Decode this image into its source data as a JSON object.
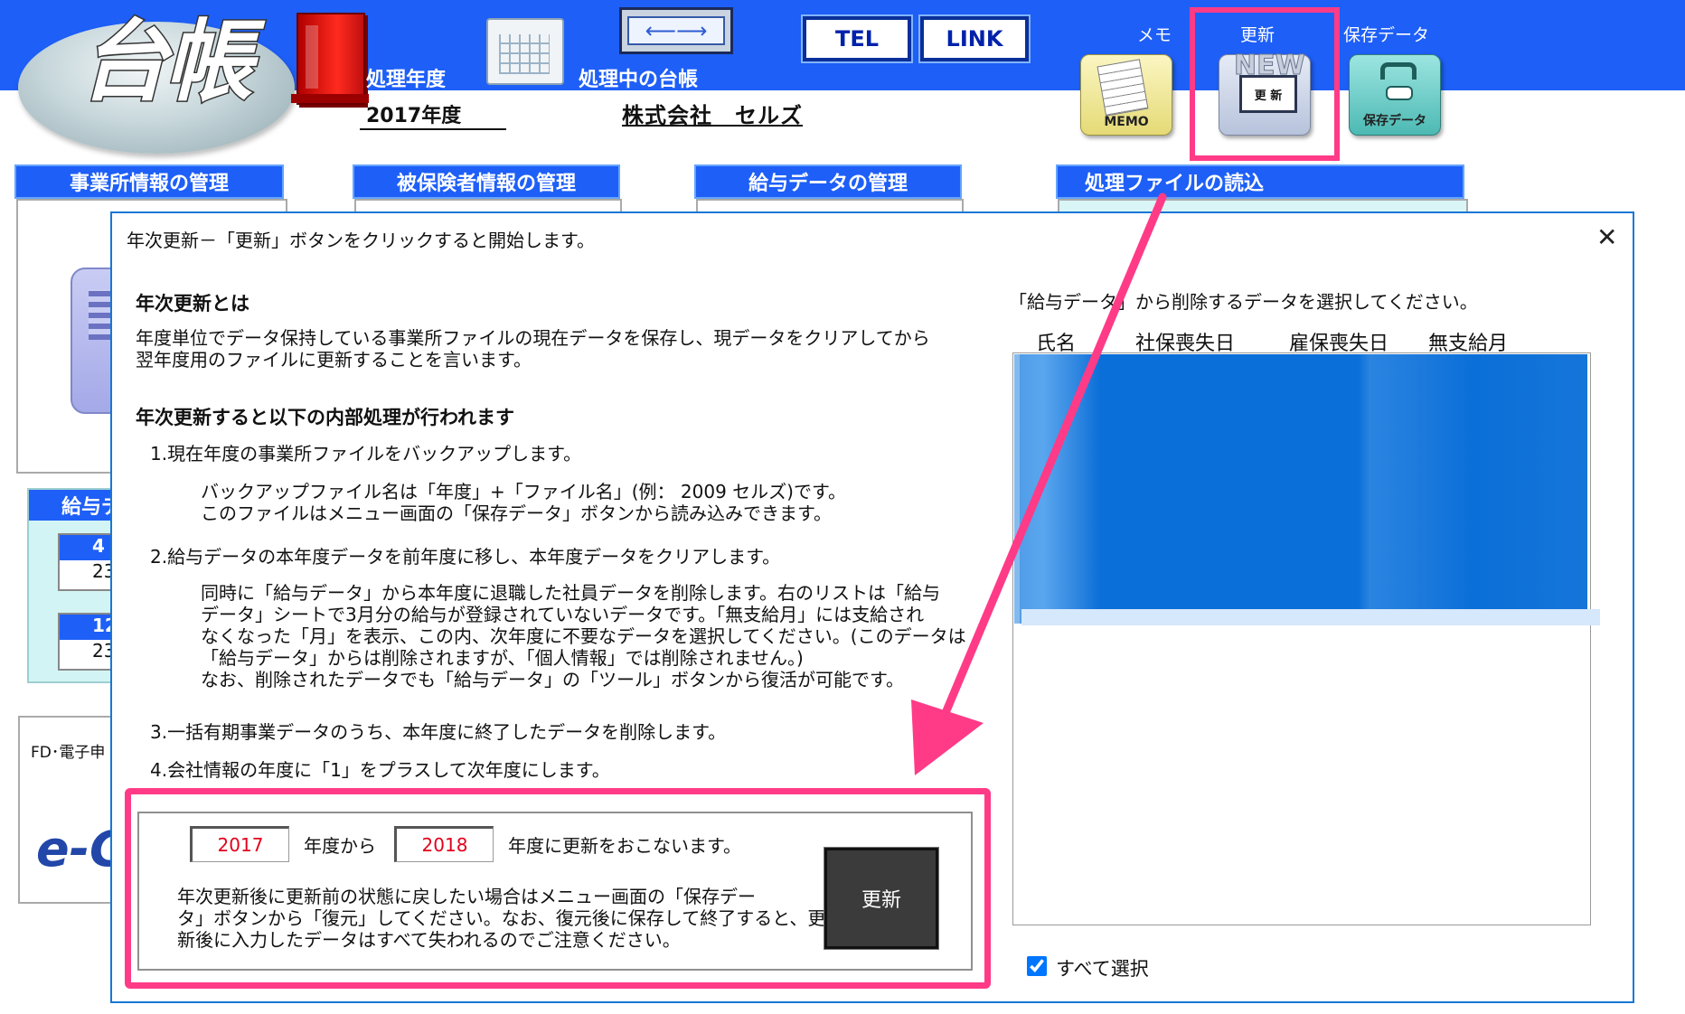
{
  "header": {
    "logo_text": "台帳",
    "processing_year_label": "処理年度",
    "processing_ledger_label": "処理中の台帳",
    "processing_year_value": "2017年度",
    "company_name": "株式会社　セルズ",
    "tel_button": "TEL",
    "link_button": "LINK",
    "memo_caption": "メモ",
    "update_caption": "更新",
    "save_caption": "保存データ",
    "memo_icon_text": "MEMO",
    "new_icon_word": "NEW",
    "new_icon_screen_text": "更 新",
    "save_icon_text": "保存データ",
    "arrow_glyph": "⟵⟶"
  },
  "sections": {
    "office": "事業所情報の管理",
    "insured": "被保険者情報の管理",
    "salary": "給与データの管理",
    "load_file": "処理ファイルの読込",
    "salary_panel_title": "給与デ",
    "salary_box_1_top": "4",
    "salary_box_1_bottom": "23",
    "salary_box_2_top": "12",
    "salary_box_2_bottom": "23",
    "efile_label": "FD･電子申",
    "efile_logo": "e-G"
  },
  "dialog": {
    "title": "年次更新－「更新」ボタンをクリックすると開始します。",
    "close_glyph": "✕",
    "what_heading": "年次更新とは",
    "what_lines": [
      "年度単位でデータ保持している事業所ファイルの現在データを保存し、現データをクリアしてから",
      "翌年度用のファイルに更新することを言います。"
    ],
    "process_heading": "年次更新すると以下の内部処理が行われます",
    "step1": "1.現在年度の事業所ファイルをバックアップします。",
    "step1_detail": [
      "バックアップファイル名は「年度」+「ファイル名」(例： 2009 セルズ)です。",
      "このファイルはメニュー画面の「保存データ」ボタンから読み込みできます。"
    ],
    "step2": "2.給与データの本年度データを前年度に移し、本年度データをクリアします。",
    "step2_detail": [
      "同時に「給与データ」から本年度に退職した社員データを削除します。右のリストは「給与",
      "データ」シートで3月分の給与が登録されていないデータです。「無支給月」には支給され",
      "なくなった「月」を表示、この内、次年度に不要なデータを選択してください。(このデータは",
      "「給与データ」からは削除されますが、「個人情報」では削除されません。)",
      "なお、削除されたデータでも「給与データ」の「ツール」ボタンから復活が可能です。"
    ],
    "step3": "3.一括有期事業データのうち、本年度に終了したデータを削除します。",
    "step4": "4.会社情報の年度に「1」をプラスして次年度にします。",
    "from_year": "2017",
    "to_year": "2018",
    "from_label": "年度から",
    "to_label": "年度に更新をおこないます。",
    "note_lines": [
      "年次更新後に更新前の状態に戻したい場合はメニュー画面の「保存デー",
      "タ」ボタンから「復元」してください。なお、復元後に保存して終了すると、更",
      "新後に入力したデータはすべて失われるのでご注意ください。"
    ],
    "update_button": "更新",
    "list_caption": "「給与データ」から削除するデータを選択してください。",
    "list_headers": [
      "氏名",
      "社保喪失日",
      "雇保喪失日",
      "無支給月"
    ],
    "select_all_label": "すべて選択",
    "select_all_checked": true
  },
  "annotation_color": "#ff3b87"
}
